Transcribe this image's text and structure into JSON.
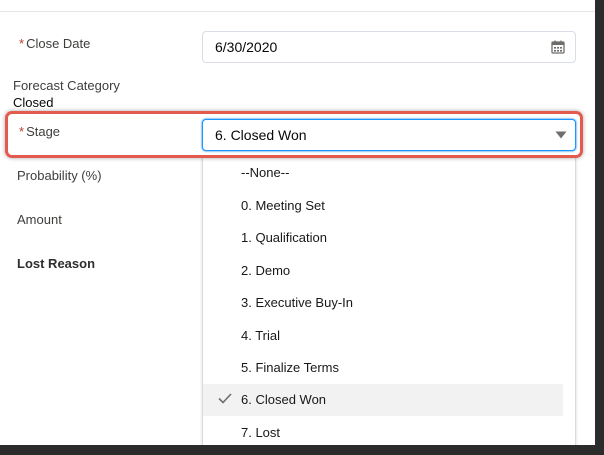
{
  "form": {
    "close_date": {
      "required_mark": "*",
      "label": "Close Date",
      "value": "6/30/2020",
      "icon": "calendar-icon"
    },
    "forecast_category": {
      "label": "Forecast Category",
      "value": "Closed"
    },
    "stage": {
      "required_mark": "*",
      "label": "Stage",
      "value": "6. Closed Won",
      "icon": "chevron-down-icon"
    },
    "probability": {
      "label": "Probability (%)"
    },
    "amount": {
      "label": "Amount"
    },
    "lost_reason": {
      "label": "Lost Reason"
    }
  },
  "stage_dropdown": {
    "options": [
      {
        "label": "--None--",
        "selected": false
      },
      {
        "label": "0. Meeting Set",
        "selected": false
      },
      {
        "label": "1. Qualification",
        "selected": false
      },
      {
        "label": "2. Demo",
        "selected": false
      },
      {
        "label": "3. Executive Buy-In",
        "selected": false
      },
      {
        "label": "4. Trial",
        "selected": false
      },
      {
        "label": "5. Finalize Terms",
        "selected": false
      },
      {
        "label": "6. Closed Won",
        "selected": true
      },
      {
        "label": "7. Lost",
        "selected": false
      }
    ]
  },
  "colors": {
    "highlight": "#e25b4e",
    "required": "#c23934",
    "focus_border": "#1b96ff"
  }
}
